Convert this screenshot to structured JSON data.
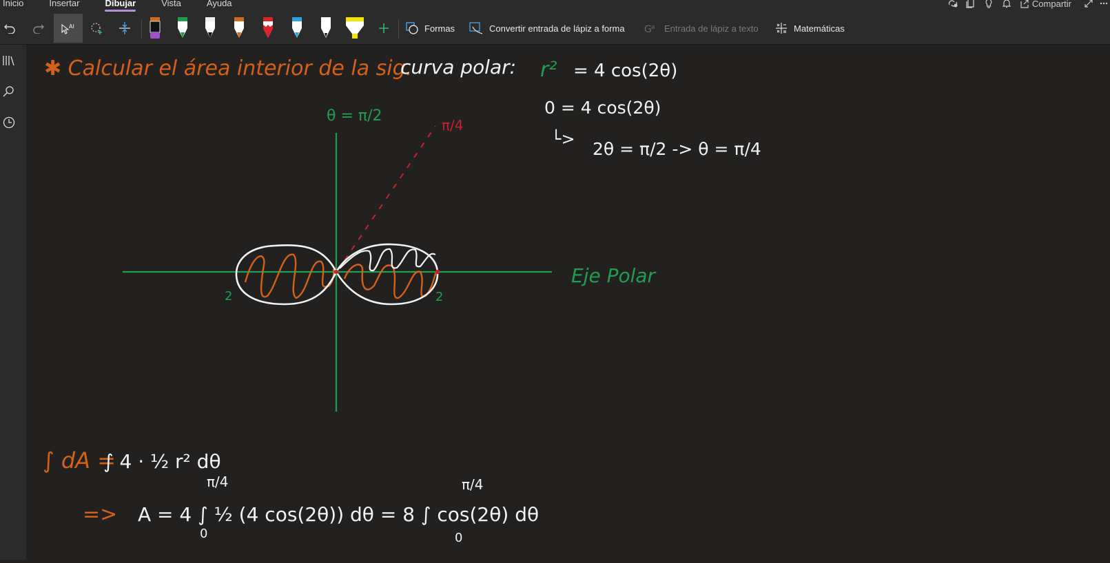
{
  "ribbon": {
    "tabs": [
      "Inicio",
      "Insertar",
      "Dibujar",
      "Vista",
      "Ayuda"
    ],
    "active_tab": "Dibujar",
    "share_label": "Compartir",
    "tools": {
      "shapes_label": "Formas",
      "ink_to_shape_label": "Convertir entrada de lápiz a forma",
      "ink_to_text_label": "Entrada de lápiz a texto",
      "math_label": "Matemáticas"
    },
    "pens": [
      {
        "icon": "pen-icon",
        "color": "#a14fc4"
      },
      {
        "icon": "pen-icon",
        "color": "#1f9e50"
      },
      {
        "icon": "pen-icon",
        "color": "#ffffff"
      },
      {
        "icon": "pen-icon",
        "color": "#d2691e"
      },
      {
        "icon": "pen-icon",
        "color": "#e0202a"
      },
      {
        "icon": "pen-icon",
        "color": "#2aa4e0"
      },
      {
        "icon": "pen-icon",
        "color": "#ffffff"
      },
      {
        "icon": "highlighter-icon",
        "color": "#f5e400"
      }
    ],
    "accent_color": "#b68ddb"
  },
  "notes": {
    "title_orange": "✱ Calcular el área interior de la sig.",
    "title_white": "curva polar:",
    "equation_r2": "r²",
    "equation_rhs": "= 4 cos(2θ)",
    "step1": "0 = 4 cos(2θ)",
    "step2_arrow": "└>",
    "step2": "2θ = π/2 -> θ = π/4",
    "theta_pi2": "θ = π/2",
    "pi4_label": "π/4",
    "polar_axis_label": "Eje Polar",
    "label_2_left": "2",
    "label_2_right": "2",
    "integral_line1_orange": "∫ dA =",
    "integral_line1_white": "∫ 4 · ½ r² dθ",
    "integral_line2_arrow": "=>",
    "integral_line2": "A = 4 ∫ ½ (4 cos(2θ)) dθ  =  8 ∫ cos(2θ) dθ",
    "upper_limit_1": "π/4",
    "upper_limit_2": "π/4",
    "lower_limit_1": "0",
    "lower_limit_2": "0"
  },
  "colors": {
    "orange": "#d4601a",
    "green": "#1f9e50",
    "white": "#f2f2f2",
    "red": "#c8202e"
  }
}
